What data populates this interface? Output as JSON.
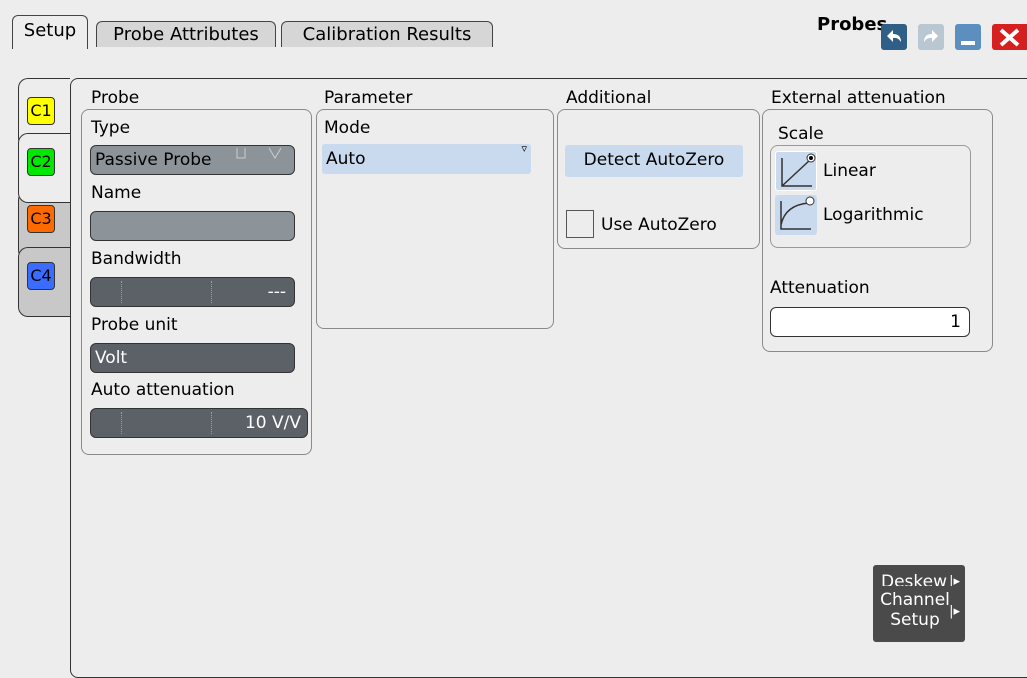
{
  "tabs": [
    {
      "label": "Setup",
      "active": true
    },
    {
      "label": "Probe Attributes",
      "active": false
    },
    {
      "label": "Calibration Results",
      "active": false
    }
  ],
  "window": {
    "title": "Probes"
  },
  "channels": [
    {
      "label": "C1",
      "color": "#ffff00"
    },
    {
      "label": "C2",
      "color": "#00e800"
    },
    {
      "label": "C3",
      "color": "#ff6a00"
    },
    {
      "label": "C4",
      "color": "#3a6cff"
    }
  ],
  "probe": {
    "heading": "Probe",
    "type_label": "Type",
    "type_value": "Passive Probe",
    "name_label": "Name",
    "name_value": "",
    "bandwidth_label": "Bandwidth",
    "bandwidth_value": "---",
    "unit_label": "Probe unit",
    "unit_value": "Volt",
    "auto_att_label": "Auto attenuation",
    "auto_att_value": "10 V/V"
  },
  "parameter": {
    "heading": "Parameter",
    "mode_label": "Mode",
    "mode_value": "Auto"
  },
  "additional": {
    "heading": "Additional",
    "detect_label": "Detect AutoZero",
    "use_label": "Use AutoZero",
    "use_checked": false
  },
  "external": {
    "heading": "External attenuation",
    "scale_label": "Scale",
    "linear_label": "Linear",
    "log_label": "Logarithmic",
    "selected_scale": "Linear",
    "attenuation_label": "Attenuation",
    "attenuation_value": "1"
  },
  "buttons": {
    "deskew": "Deskew",
    "channel_setup_line1": "Channel",
    "channel_setup_line2": "Setup"
  }
}
